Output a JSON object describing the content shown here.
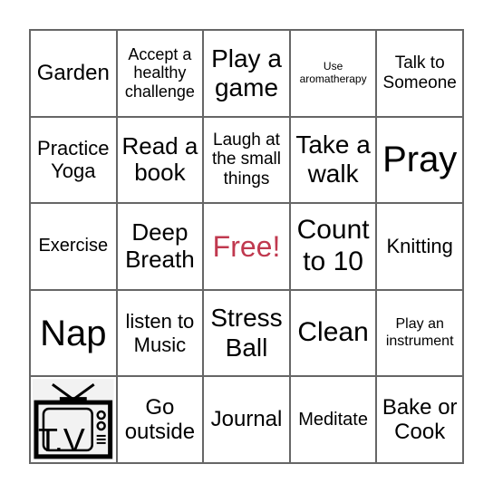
{
  "board": {
    "cells": [
      {
        "text": "Garden",
        "size": 24
      },
      {
        "text": "Accept a healthy challenge",
        "size": 18
      },
      {
        "text": "Play a game",
        "size": 28
      },
      {
        "text": "Use aromatherapy",
        "size": 12
      },
      {
        "text": "Talk to Someone",
        "size": 19
      },
      {
        "text": "Practice Yoga",
        "size": 22
      },
      {
        "text": "Read a book",
        "size": 26
      },
      {
        "text": "Laugh at the small things",
        "size": 19
      },
      {
        "text": "Take a walk",
        "size": 28
      },
      {
        "text": "Pray",
        "size": 40
      },
      {
        "text": "Exercise",
        "size": 20
      },
      {
        "text": "Deep Breath",
        "size": 26
      },
      {
        "text": "Free!",
        "size": 32,
        "free": true
      },
      {
        "text": "Count to 10",
        "size": 30
      },
      {
        "text": "Knitting",
        "size": 22
      },
      {
        "text": "Nap",
        "size": 40
      },
      {
        "text": "listen to Music",
        "size": 22
      },
      {
        "text": "Stress Ball",
        "size": 28
      },
      {
        "text": "Clean",
        "size": 30
      },
      {
        "text": "Play an instrument",
        "size": 16
      },
      {
        "text": "",
        "image": "tv-icon"
      },
      {
        "text": "Go outside",
        "size": 24
      },
      {
        "text": "Journal",
        "size": 24
      },
      {
        "text": "Meditate",
        "size": 20
      },
      {
        "text": "Bake or Cook",
        "size": 24
      }
    ]
  }
}
